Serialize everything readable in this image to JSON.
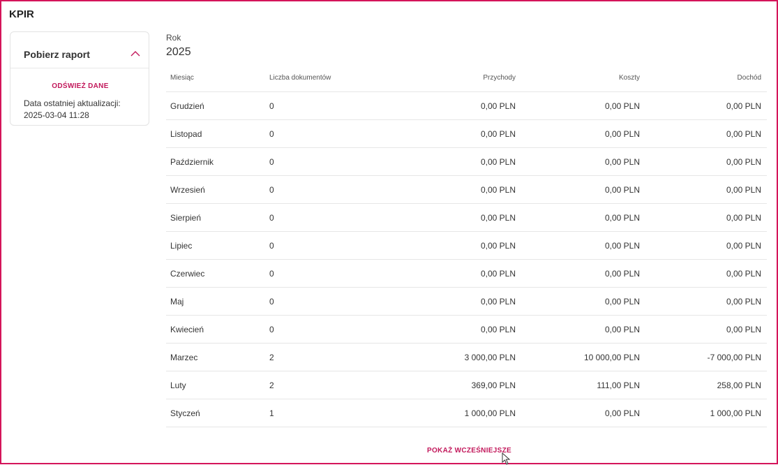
{
  "page": {
    "title": "KPIR"
  },
  "report_card": {
    "title": "Pobierz raport",
    "refresh_label": "ODŚWIEŻ DANE",
    "last_update_label": "Data ostatniej aktualizacji:",
    "last_update_value": "2025-03-04 11:28",
    "expanded": true
  },
  "year": {
    "label": "Rok",
    "value": "2025"
  },
  "table": {
    "headers": {
      "month": "Miesiąc",
      "docs": "Liczba dokumentów",
      "income": "Przychody",
      "costs": "Koszty",
      "profit": "Dochód"
    },
    "rows": [
      {
        "month": "Grudzień",
        "docs": "0",
        "income": "0,00 PLN",
        "costs": "0,00 PLN",
        "profit": "0,00 PLN"
      },
      {
        "month": "Listopad",
        "docs": "0",
        "income": "0,00 PLN",
        "costs": "0,00 PLN",
        "profit": "0,00 PLN"
      },
      {
        "month": "Październik",
        "docs": "0",
        "income": "0,00 PLN",
        "costs": "0,00 PLN",
        "profit": "0,00 PLN"
      },
      {
        "month": "Wrzesień",
        "docs": "0",
        "income": "0,00 PLN",
        "costs": "0,00 PLN",
        "profit": "0,00 PLN"
      },
      {
        "month": "Sierpień",
        "docs": "0",
        "income": "0,00 PLN",
        "costs": "0,00 PLN",
        "profit": "0,00 PLN"
      },
      {
        "month": "Lipiec",
        "docs": "0",
        "income": "0,00 PLN",
        "costs": "0,00 PLN",
        "profit": "0,00 PLN"
      },
      {
        "month": "Czerwiec",
        "docs": "0",
        "income": "0,00 PLN",
        "costs": "0,00 PLN",
        "profit": "0,00 PLN"
      },
      {
        "month": "Maj",
        "docs": "0",
        "income": "0,00 PLN",
        "costs": "0,00 PLN",
        "profit": "0,00 PLN"
      },
      {
        "month": "Kwiecień",
        "docs": "0",
        "income": "0,00 PLN",
        "costs": "0,00 PLN",
        "profit": "0,00 PLN"
      },
      {
        "month": "Marzec",
        "docs": "2",
        "income": "3 000,00 PLN",
        "costs": "10 000,00 PLN",
        "profit": "-7 000,00 PLN"
      },
      {
        "month": "Luty",
        "docs": "2",
        "income": "369,00 PLN",
        "costs": "111,00 PLN",
        "profit": "258,00 PLN"
      },
      {
        "month": "Styczeń",
        "docs": "1",
        "income": "1 000,00 PLN",
        "costs": "0,00 PLN",
        "profit": "1 000,00 PLN"
      }
    ]
  },
  "show_more_label": "POKAŻ WCZEŚNIEJSZE",
  "colors": {
    "accent": "#c2185b",
    "frame_border": "#d4145a",
    "divider": "#e6e6e6"
  },
  "icons": {
    "collapse": "chevron-up-icon",
    "pointer": "mouse-cursor-icon"
  }
}
